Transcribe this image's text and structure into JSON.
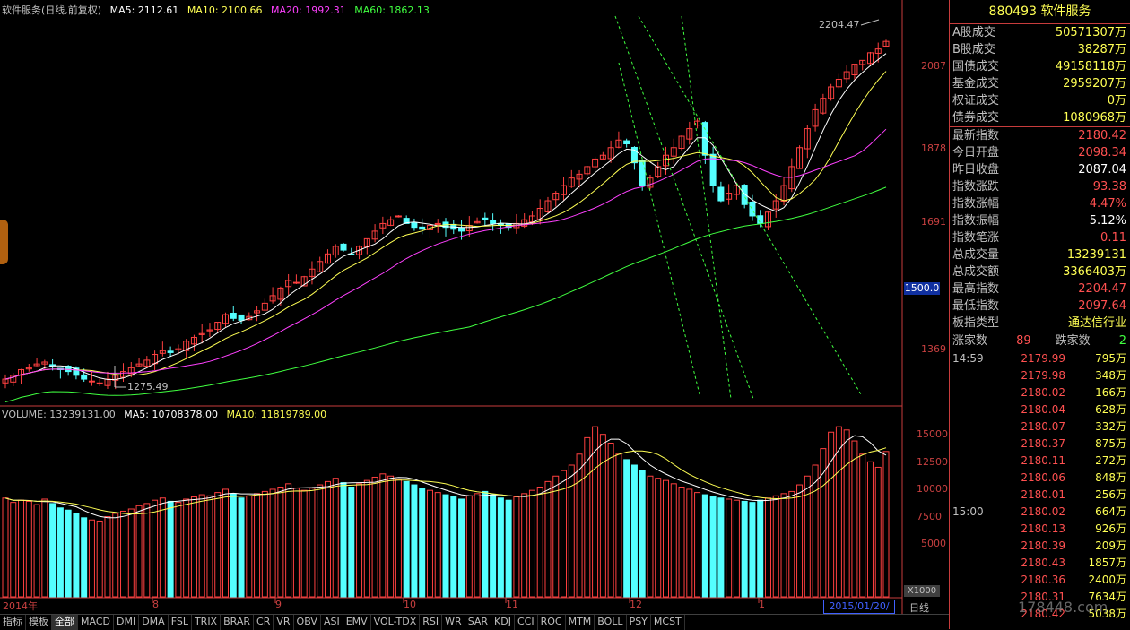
{
  "main_legend": {
    "title": "软件服务(日线,前复权)",
    "ma5": "MA5: 2112.61",
    "ma10": "MA10: 2100.66",
    "ma20": "MA20: 1992.31",
    "ma60": "MA60: 1862.13",
    "colors": {
      "ma5": "#ffffff",
      "ma10": "#ffff54",
      "ma20": "#ff40ff",
      "ma60": "#40ff40"
    }
  },
  "vol_legend": {
    "volume": "VOLUME: 13239131.00",
    "ma5": "MA5: 10708378.00",
    "ma10": "MA10: 11819789.00"
  },
  "annotations": {
    "high": "2204.47",
    "low": "1275.49"
  },
  "price_ticks": [
    "2087",
    "1878",
    "1691",
    "1369"
  ],
  "price_tag": "1500.0",
  "volume_ticks": [
    "15000",
    "12500",
    "10000",
    "7500",
    "5000"
  ],
  "volume_unit": "X1000",
  "x_ticks": [
    "2014年",
    "8",
    "9",
    "10",
    "11",
    "12",
    "1"
  ],
  "cursor_date": "2015/01/20/二",
  "right_panel": {
    "title": "880493 软件服务",
    "section1": [
      {
        "k": "A股成交",
        "v": "50571307万",
        "c": "#ffff54"
      },
      {
        "k": "B股成交",
        "v": "38287万",
        "c": "#ffff54"
      },
      {
        "k": "国债成交",
        "v": "49158118万",
        "c": "#ffff54"
      },
      {
        "k": "基金成交",
        "v": "2959207万",
        "c": "#ffff54"
      },
      {
        "k": "权证成交",
        "v": "0万",
        "c": "#ffff54"
      },
      {
        "k": "债券成交",
        "v": "1080968万",
        "c": "#ffff54"
      }
    ],
    "section2": [
      {
        "k": "最新指数",
        "v": "2180.42",
        "c": "#ff5050"
      },
      {
        "k": "今日开盘",
        "v": "2098.34",
        "c": "#ff5050"
      },
      {
        "k": "昨日收盘",
        "v": "2087.04",
        "c": "#ffffff"
      },
      {
        "k": "指数涨跌",
        "v": "93.38",
        "c": "#ff5050"
      },
      {
        "k": "指数涨幅",
        "v": "4.47%",
        "c": "#ff5050"
      },
      {
        "k": "指数振幅",
        "v": "5.12%",
        "c": "#ffffff"
      },
      {
        "k": "指数笔涨",
        "v": "0.11",
        "c": "#ff5050"
      },
      {
        "k": "总成交量",
        "v": "13239131",
        "c": "#ffff54"
      },
      {
        "k": "总成交额",
        "v": "3366403万",
        "c": "#ffff54"
      },
      {
        "k": "最高指数",
        "v": "2204.47",
        "c": "#ff5050"
      },
      {
        "k": "最低指数",
        "v": "2097.64",
        "c": "#ff5050"
      },
      {
        "k": "板指类型",
        "v": "通达信行业",
        "c": "#ffff54"
      }
    ],
    "breadth": {
      "up_label": "涨家数",
      "up": "89",
      "down_label": "跌家数",
      "down": "2"
    },
    "ticks": [
      {
        "t": "14:59",
        "p": "2179.99",
        "v": "795万"
      },
      {
        "t": "",
        "p": "2179.98",
        "v": "348万"
      },
      {
        "t": "",
        "p": "2180.02",
        "v": "166万"
      },
      {
        "t": "",
        "p": "2180.04",
        "v": "628万"
      },
      {
        "t": "",
        "p": "2180.07",
        "v": "332万"
      },
      {
        "t": "",
        "p": "2180.37",
        "v": "875万"
      },
      {
        "t": "",
        "p": "2180.11",
        "v": "272万"
      },
      {
        "t": "",
        "p": "2180.06",
        "v": "848万"
      },
      {
        "t": "",
        "p": "2180.01",
        "v": "256万"
      },
      {
        "t": "15:00",
        "p": "2180.02",
        "v": "664万"
      },
      {
        "t": "",
        "p": "2180.13",
        "v": "926万"
      },
      {
        "t": "",
        "p": "2180.39",
        "v": "209万"
      },
      {
        "t": "",
        "p": "2180.43",
        "v": "1857万"
      },
      {
        "t": "",
        "p": "2180.36",
        "v": "2400万"
      },
      {
        "t": "",
        "p": "2180.31",
        "v": "7634万"
      },
      {
        "t": "",
        "p": "2180.42",
        "v": "5038万"
      }
    ]
  },
  "bottom_left": "日线",
  "bottom_tabs": [
    "指标",
    "模板",
    "全部",
    "MACD",
    "DMI",
    "DMA",
    "FSL",
    "TRIX",
    "BRAR",
    "CR",
    "VR",
    "OBV",
    "ASI",
    "EMV",
    "VOL-TDX",
    "RSI",
    "WR",
    "SAR",
    "KDJ",
    "CCI",
    "ROC",
    "MTM",
    "BOLL",
    "PSY",
    "MCST"
  ],
  "watermark": "178448.com",
  "chart_data": {
    "type": "candlestick",
    "ma_closes": [
      1290,
      1300,
      1315,
      1320,
      1330,
      1335,
      1325,
      1315,
      1310,
      1300,
      1290,
      1285,
      1280,
      1290,
      1300,
      1310,
      1320,
      1330,
      1340,
      1355,
      1365,
      1360,
      1370,
      1390,
      1400,
      1410,
      1420,
      1440,
      1460,
      1450,
      1445,
      1455,
      1470,
      1490,
      1510,
      1530,
      1550,
      1545,
      1560,
      1580,
      1600,
      1620,
      1640,
      1630,
      1620,
      1640,
      1660,
      1680,
      1700,
      1710,
      1720,
      1700,
      1690,
      1685,
      1695,
      1700,
      1690,
      1685,
      1680,
      1695,
      1705,
      1710,
      1700,
      1695,
      1690,
      1700,
      1710,
      1720,
      1740,
      1760,
      1780,
      1800,
      1820,
      1830,
      1850,
      1870,
      1880,
      1900,
      1920,
      1910,
      1860,
      1800,
      1820,
      1850,
      1880,
      1900,
      1930,
      1950,
      1970,
      1880,
      1800,
      1760,
      1780,
      1800,
      1750,
      1720,
      1700,
      1730,
      1760,
      1800,
      1850,
      1900,
      1950,
      2000,
      2030,
      2060,
      2080,
      2100,
      2120,
      2130,
      2150,
      2160,
      2180
    ],
    "volumes": [
      9000,
      8600,
      8800,
      8700,
      8400,
      8900,
      8500,
      8100,
      7900,
      7600,
      7200,
      7000,
      6900,
      7300,
      7600,
      7800,
      8000,
      8300,
      8500,
      8800,
      9000,
      8700,
      8600,
      8900,
      9100,
      9300,
      9200,
      9500,
      9800,
      9400,
      9000,
      9200,
      9400,
      9600,
      9800,
      10000,
      10300,
      9900,
      9700,
      9900,
      10200,
      10500,
      10800,
      10400,
      10000,
      10300,
      10600,
      10900,
      11200,
      11000,
      10700,
      10500,
      10200,
      9900,
      9700,
      9500,
      9300,
      9100,
      8900,
      9200,
      9400,
      9600,
      9300,
      9000,
      8800,
      9100,
      9400,
      9700,
      10000,
      10500,
      11000,
      11500,
      12000,
      13000,
      14500,
      15500,
      14800,
      14000,
      13000,
      12500,
      12000,
      11500,
      11000,
      10800,
      10600,
      10300,
      10000,
      9800,
      9500,
      9300,
      9100,
      9000,
      8900,
      8800,
      8700,
      8600,
      8800,
      9000,
      9200,
      9400,
      9600,
      10200,
      11000,
      12000,
      13500,
      15000,
      15500,
      15200,
      14200,
      13000,
      12300,
      11800,
      13239
    ]
  }
}
